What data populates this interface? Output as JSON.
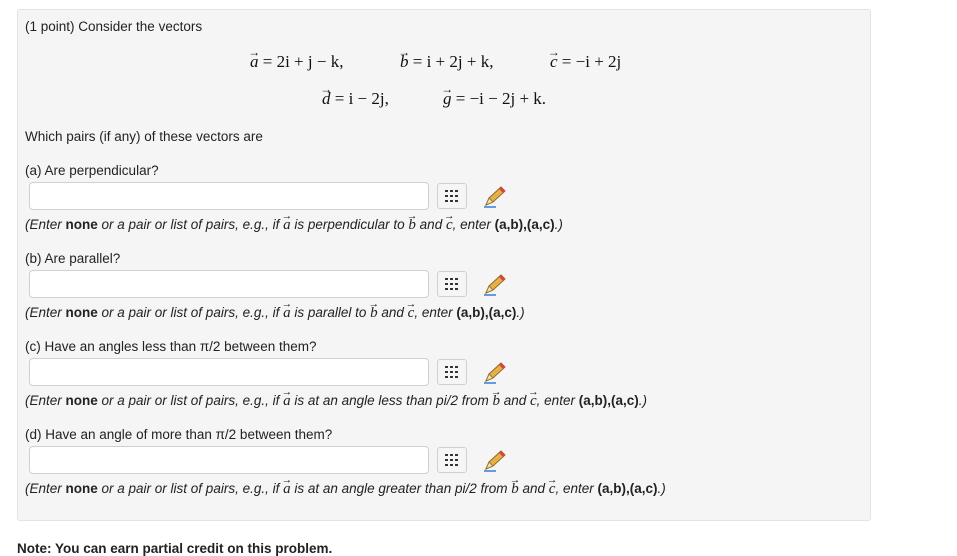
{
  "problem": {
    "intro": "(1 point) Consider the vectors",
    "question_lead": "Which pairs (if any) of these vectors are"
  },
  "vectors_line1": {
    "a": {
      "name": "a",
      "expr": "= 2i + j − k,"
    },
    "b": {
      "name": "b",
      "expr": "= i + 2j + k,"
    },
    "c": {
      "name": "c",
      "expr": "= −i + 2j"
    }
  },
  "vectors_line2": {
    "d": {
      "name": "d",
      "expr": "= i − 2j,"
    },
    "g": {
      "name": "g",
      "expr": "= −i − 2j + k."
    }
  },
  "parts": [
    {
      "label": "(a) Are perpendicular?",
      "value": "",
      "hint_pre": "(Enter ",
      "hint_none": "none",
      "hint_mid": " or a pair or list of pairs, e.g., if ",
      "hint_rel": " is perpendicular to ",
      "hint_and": " and ",
      "hint_enter": ", enter ",
      "hint_example": "(a,b),(a,c)",
      "hint_end": ".)"
    },
    {
      "label": "(b) Are parallel?",
      "value": "",
      "hint_pre": "(Enter ",
      "hint_none": "none",
      "hint_mid": " or a pair or list of pairs, e.g., if ",
      "hint_rel": " is parallel to ",
      "hint_and": " and ",
      "hint_enter": ", enter ",
      "hint_example": "(a,b),(a,c)",
      "hint_end": ".)"
    },
    {
      "label": "(c) Have an angles less than π/2 between them?",
      "value": "",
      "hint_pre": "(Enter ",
      "hint_none": "none",
      "hint_mid": " or a pair or list of pairs, e.g., if ",
      "hint_rel": " is at an angle less than pi/2 from ",
      "hint_and": " and ",
      "hint_enter": ", enter ",
      "hint_example": "(a,b),(a,c)",
      "hint_end": ".)"
    },
    {
      "label": "(d) Have an angle of more than π/2 between them?",
      "value": "",
      "hint_pre": "(Enter ",
      "hint_none": "none",
      "hint_mid": " or a pair or list of pairs, e.g., if ",
      "hint_rel": " is at an angle greater than pi/2 from ",
      "hint_and": " and ",
      "hint_enter": ", enter ",
      "hint_example": "(a,b),(a,c)",
      "hint_end": ".)"
    }
  ],
  "hint_vectors": {
    "first": "a",
    "second": "b",
    "third": "c"
  },
  "footer_note": "Note: You can earn partial credit on this problem.",
  "icons": {
    "equation_editor": "grid-icon",
    "scratch": "pencil-icon"
  },
  "colors": {
    "panel_bg": "#f5f5f5",
    "pencil_body": "#e8b04a"
  }
}
